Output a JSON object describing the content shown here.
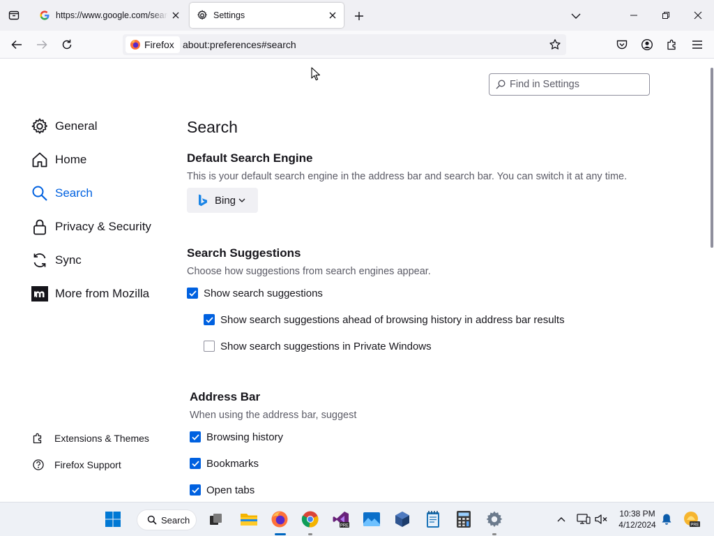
{
  "tabs": [
    {
      "title": "https://www.google.com/search",
      "favicon": "google-g-icon",
      "active": false
    },
    {
      "title": "Settings",
      "favicon": "gear-icon",
      "active": true
    }
  ],
  "navbar": {
    "identity_label": "Firefox",
    "url": "about:preferences#search"
  },
  "find_settings": {
    "placeholder": "Find in Settings"
  },
  "categories": [
    {
      "label": "General",
      "icon": "gear-icon"
    },
    {
      "label": "Home",
      "icon": "home-icon"
    },
    {
      "label": "Search",
      "icon": "search-icon",
      "selected": true
    },
    {
      "label": "Privacy & Security",
      "icon": "lock-icon"
    },
    {
      "label": "Sync",
      "icon": "sync-icon"
    },
    {
      "label": "More from Mozilla",
      "icon": "mozilla-m-icon"
    }
  ],
  "sidebar_links": [
    {
      "label": "Extensions & Themes",
      "icon": "puzzle-icon"
    },
    {
      "label": "Firefox Support",
      "icon": "help-icon"
    }
  ],
  "page": {
    "title": "Search",
    "default_engine": {
      "heading": "Default Search Engine",
      "description": "This is your default search engine in the address bar and search bar. You can switch it at any time.",
      "selected": "Bing"
    },
    "suggestions": {
      "heading": "Search Suggestions",
      "description": "Choose how suggestions from search engines appear.",
      "options": [
        {
          "label": "Show search suggestions",
          "checked": true
        },
        {
          "label": "Show search suggestions ahead of browsing history in address bar results",
          "checked": true
        },
        {
          "label": "Show search suggestions in Private Windows",
          "checked": false
        }
      ]
    },
    "address_bar": {
      "heading": "Address Bar",
      "description": "When using the address bar, suggest",
      "options": [
        {
          "label": "Browsing history",
          "checked": true
        },
        {
          "label": "Bookmarks",
          "checked": true
        },
        {
          "label": "Open tabs",
          "checked": true
        }
      ]
    }
  },
  "taskbar": {
    "search_label": "Search",
    "apps": [
      "start-icon",
      "task-view-icon",
      "file-explorer-icon",
      "firefox-icon",
      "chrome-icon",
      "visual-studio-preview-icon",
      "photos-icon",
      "virtualbox-icon",
      "notepad-icon",
      "calculator-icon",
      "settings-icon"
    ],
    "time": "10:38 PM",
    "date": "4/12/2024"
  },
  "colors": {
    "accent": "#0061e0",
    "text": "#15141a",
    "secondary_text": "#5b5b66"
  }
}
